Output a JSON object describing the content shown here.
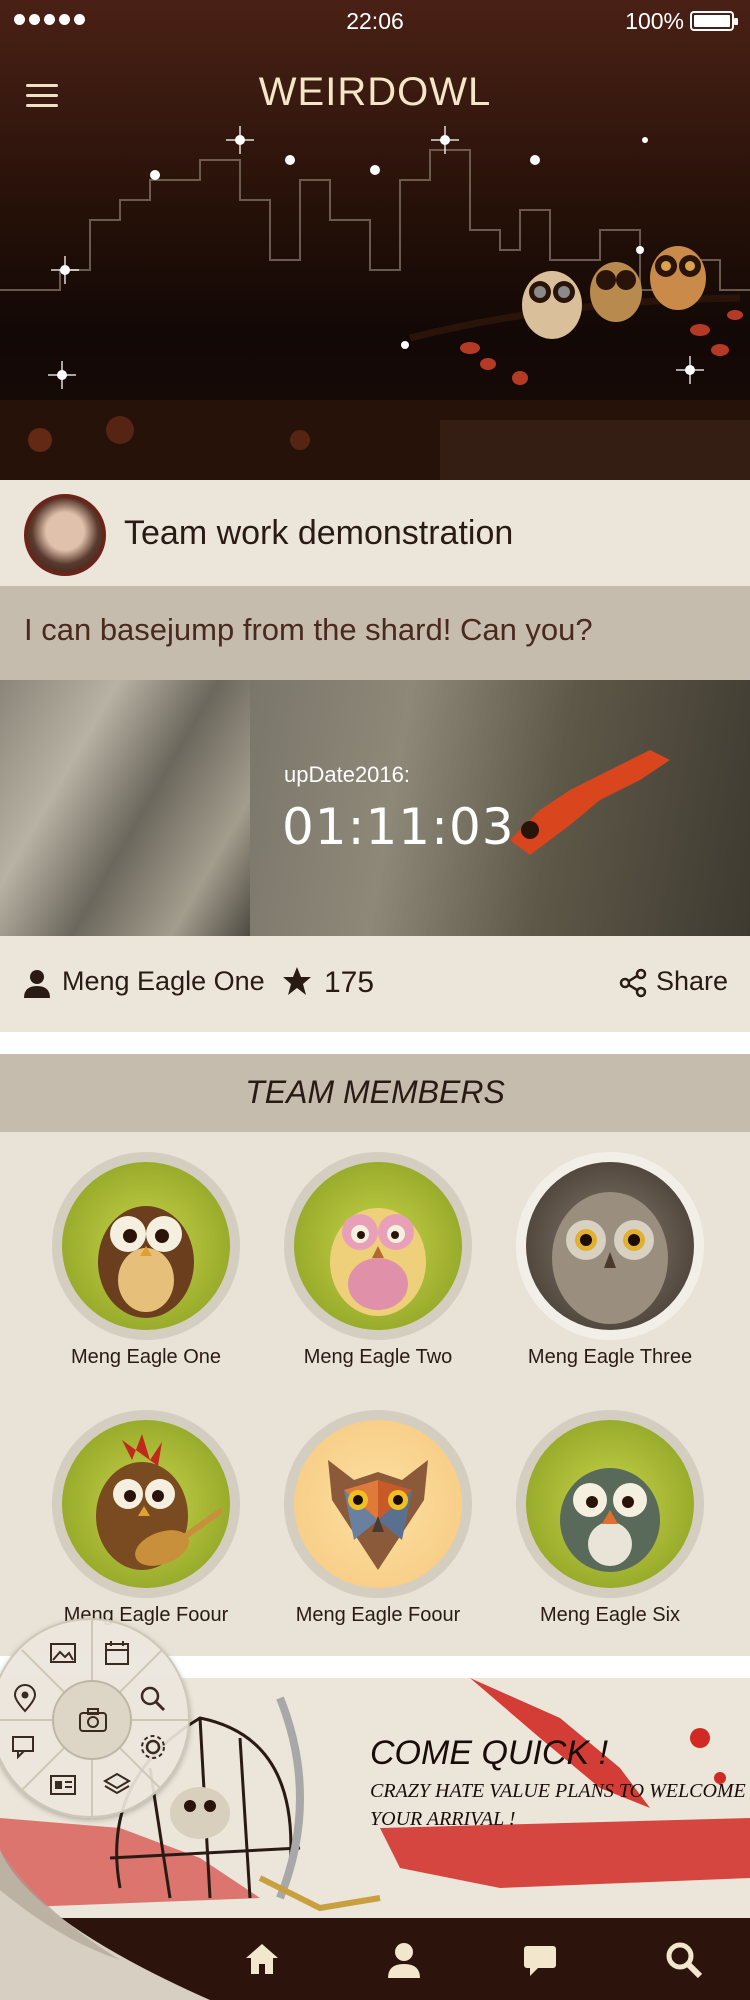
{
  "status_bar": {
    "time": "22:06",
    "battery": "100%"
  },
  "header": {
    "app_title": "WEIRDOWL"
  },
  "post": {
    "title": "Team work demonstration",
    "quote": "I can basejump from the shard! Can you?",
    "update_label": "upDate2016:",
    "update_time": "01:11:03",
    "author": "Meng Eagle One",
    "stars": "175",
    "share_label": "Share"
  },
  "team": {
    "title": "TEAM MEMBERS",
    "members": [
      {
        "name": "Meng Eagle One"
      },
      {
        "name": "Meng Eagle Two"
      },
      {
        "name": "Meng Eagle Three"
      },
      {
        "name": "Meng Eagle Foour"
      },
      {
        "name": "Meng Eagle Foour"
      },
      {
        "name": "Meng Eagle Six"
      }
    ]
  },
  "promo": {
    "title": "COME QUICK !",
    "line1": "CRAZY HATE VALUE PLANS TO WELCOME",
    "line2": "YOUR ARRIVAL !"
  },
  "radial_menu": {
    "items": [
      "image-icon",
      "calendar-icon",
      "search-icon",
      "settings-icon",
      "layers-icon",
      "id-card-icon",
      "chat-icon",
      "location-icon"
    ],
    "center": "camera-icon"
  },
  "tabbar": {
    "items": [
      "settings-icon",
      "home-icon",
      "profile-icon",
      "message-icon",
      "search-icon"
    ]
  },
  "colors": {
    "header_dark": "#2c140c",
    "accent_text": "#f6e6c8",
    "gray_bar": "#c6bcae",
    "cream": "#ece6da"
  }
}
